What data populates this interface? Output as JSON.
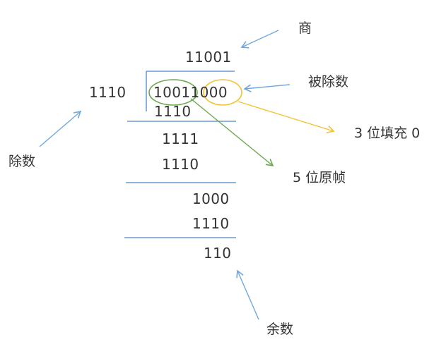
{
  "division": {
    "divisor": "1110",
    "dividend": "10011000",
    "quotient": "11001",
    "steps": [
      {
        "subtract": "1110"
      },
      {
        "partial": "1111",
        "subtract": "1110"
      },
      {
        "partial": "1000",
        "subtract": "1110"
      }
    ],
    "remainder": "110"
  },
  "labels": {
    "quotient": "商",
    "dividend": "被除数",
    "divisor": "除数",
    "padding": "3 位填充 0",
    "original_frame": "5 位原帧",
    "remainder": "余数"
  },
  "colors": {
    "blue_arrow": "#6fa8dc",
    "green_mark": "#6aa84f",
    "yellow_mark": "#f1c232",
    "rule_line": "#4a86c8",
    "text": "#333333"
  }
}
